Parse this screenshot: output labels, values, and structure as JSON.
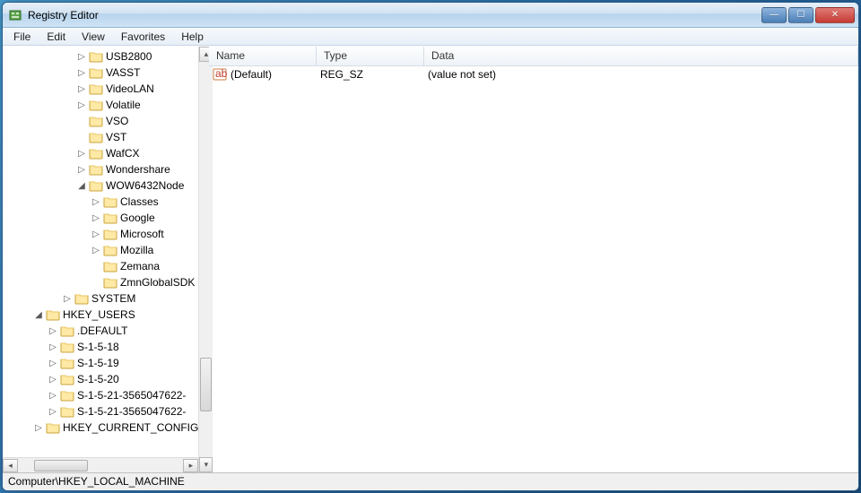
{
  "window": {
    "title": "Registry Editor"
  },
  "menu": {
    "file": "File",
    "edit": "Edit",
    "view": "View",
    "favorites": "Favorites",
    "help": "Help"
  },
  "tree": {
    "software_children": [
      {
        "name": "USB2800",
        "exp": "▷"
      },
      {
        "name": "VASST",
        "exp": "▷"
      },
      {
        "name": "VideoLAN",
        "exp": "▷"
      },
      {
        "name": "Volatile",
        "exp": "▷"
      },
      {
        "name": "VSO",
        "exp": ""
      },
      {
        "name": "VST",
        "exp": ""
      },
      {
        "name": "WafCX",
        "exp": "▷"
      },
      {
        "name": "Wondershare",
        "exp": "▷"
      }
    ],
    "wow_label": "WOW6432Node",
    "wow_children": [
      {
        "name": "Classes",
        "exp": "▷"
      },
      {
        "name": "Google",
        "exp": "▷"
      },
      {
        "name": "Microsoft",
        "exp": "▷"
      },
      {
        "name": "Mozilla",
        "exp": "▷"
      },
      {
        "name": "Zemana",
        "exp": ""
      },
      {
        "name": "ZmnGlobalSDK",
        "exp": ""
      }
    ],
    "system": "SYSTEM",
    "hku": "HKEY_USERS",
    "hku_children": [
      {
        "name": ".DEFAULT",
        "exp": "▷"
      },
      {
        "name": "S-1-5-18",
        "exp": "▷"
      },
      {
        "name": "S-1-5-19",
        "exp": "▷"
      },
      {
        "name": "S-1-5-20",
        "exp": "▷"
      },
      {
        "name": "S-1-5-21-3565047622-",
        "exp": "▷"
      },
      {
        "name": "S-1-5-21-3565047622-",
        "exp": "▷"
      }
    ],
    "hkcc": "HKEY_CURRENT_CONFIG"
  },
  "list": {
    "columns": {
      "name": "Name",
      "type": "Type",
      "data": "Data"
    },
    "rows": [
      {
        "name": "(Default)",
        "type": "REG_SZ",
        "data": "(value not set)"
      }
    ]
  },
  "status": "Computer\\HKEY_LOCAL_MACHINE"
}
